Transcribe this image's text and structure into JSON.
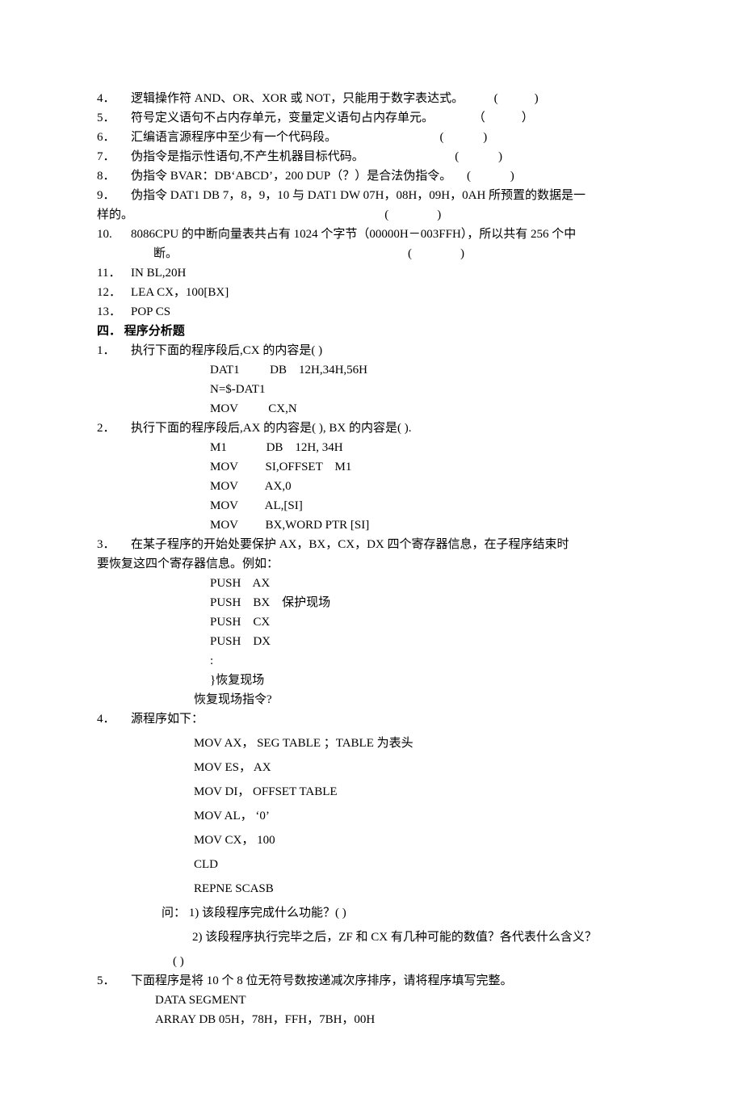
{
  "tf_items": [
    {
      "num": "4．",
      "text": "逻辑操作符 AND、OR、XOR 或 NOT，只能用于数字表达式。",
      "paren": "          (            )"
    },
    {
      "num": "5．",
      "text": "符号定义语句不占内存单元，变量定义语句占内存单元。",
      "paren": "             （            ）"
    },
    {
      "num": "6．",
      "text": "汇编语言源程序中至少有一个代码段。",
      "paren": "                                  (             )"
    },
    {
      "num": "7．",
      "text": "伪指令是指示性语句,不产生机器目标代码。",
      "paren": "                              (             )"
    },
    {
      "num": "8．",
      "text": "伪指令 BVAR：DB‘ABCD’，200 DUP（？）是合法伪指令。",
      "paren": "     (             )"
    }
  ],
  "item9": {
    "num": "9．",
    "text": "伪指令 DAT1 DB 7，8，9，10  与 DAT1 DW 07H，08H，09H，0AH 所预置的数据是一",
    "cont": "样的。",
    "paren": "                                                                                   (                )"
  },
  "item10": {
    "num": "10.",
    "text": "   8086CPU 的中断向量表共占有 1024 个字节（00000H－003FFH），所以共有 256 个中",
    "cont": "断。",
    "paren": "                                                                            (                )"
  },
  "tf_items2": [
    {
      "num": "11．",
      "text": "IN    BL,20H"
    },
    {
      "num": "12．",
      "text": "LEA CX，100[BX]"
    },
    {
      "num": "13．",
      "text": "POP CS"
    }
  ],
  "section4_title": "四．    程序分析题",
  "q1": {
    "num": "1．",
    "text": "执行下面的程序段后,CX 的内容是(              )",
    "code": [
      "DAT1          DB    12H,34H,56H",
      "N=$-DAT1",
      "MOV          CX,N"
    ]
  },
  "q2": {
    "num": "2．",
    "text": "执行下面的程序段后,AX 的内容是(              ), BX 的内容是(              ).",
    "code": [
      "M1             DB    12H, 34H",
      "MOV         SI,OFFSET    M1",
      "MOV         AX,0",
      "MOV         AL,[SI]",
      "MOV         BX,WORD PTR [SI]"
    ]
  },
  "q3": {
    "num": "3．",
    "text": "     在某子程序的开始处要保护 AX，BX，CX，DX 四个寄存器信息，在子程序结束时",
    "cont": "要恢复这四个寄存器信息。例如：",
    "code": [
      "PUSH    AX",
      "PUSH    BX    保护现场",
      "PUSH    CX",
      "PUSH    DX",
      ":",
      "}恢复现场"
    ],
    "last": "恢复现场指令?"
  },
  "q4": {
    "num": "4．",
    "text": "     源程序如下：",
    "code": [
      "MOV    AX，  SEG   TABLE  ；TABLE 为表头",
      "MOV    ES，   AX",
      "MOV    DI，   OFFSET   TABLE",
      "MOV    AL，   ‘0’",
      "MOV    CX，  100",
      "CLD",
      "REPNE    SCASB"
    ],
    "ask1": "问：  1)  该段程序完成什么功能？(                                  )",
    "ask2": "2)  该段程序执行完毕之后，ZF 和 CX 有几种可能的数值？各代表什么含义？",
    "ask3": "(                                                                                   )"
  },
  "q5": {
    "num": "5．",
    "text": "下面程序是将 10 个 8 位无符号数按递减次序排序，请将程序填写完整。",
    "code": [
      "DATA   SEGMENT",
      "ARRAY   DB   05H，78H，FFH，7BH，00H"
    ]
  }
}
